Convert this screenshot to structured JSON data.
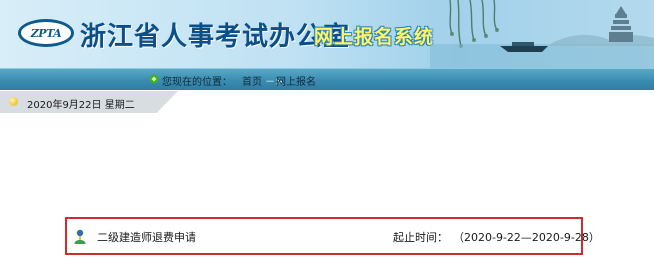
{
  "banner": {
    "logo_text": "ZPTA",
    "org_title": "浙江省人事考试办公室",
    "system_title": "网上报名系统"
  },
  "location": {
    "label": "您现在的位置：",
    "home": "首页",
    "separator": "－>",
    "current": "网上报名",
    "icon": "green-leaf-icon"
  },
  "datebar": {
    "icon": "sun-icon",
    "text": "2020年9月22日  星期二"
  },
  "applications": [
    {
      "icon": "person-icon",
      "title": "二级建造师退费申请",
      "period_label": "起止时间：",
      "period_value": "（2020-9-22—2020-9-28）"
    }
  ],
  "colors": {
    "title_blue": "#0c4f88",
    "system_title_yellow": "#fff566",
    "locbar_blue": "#3a8cb0",
    "highlight_red": "#d12c2c"
  }
}
